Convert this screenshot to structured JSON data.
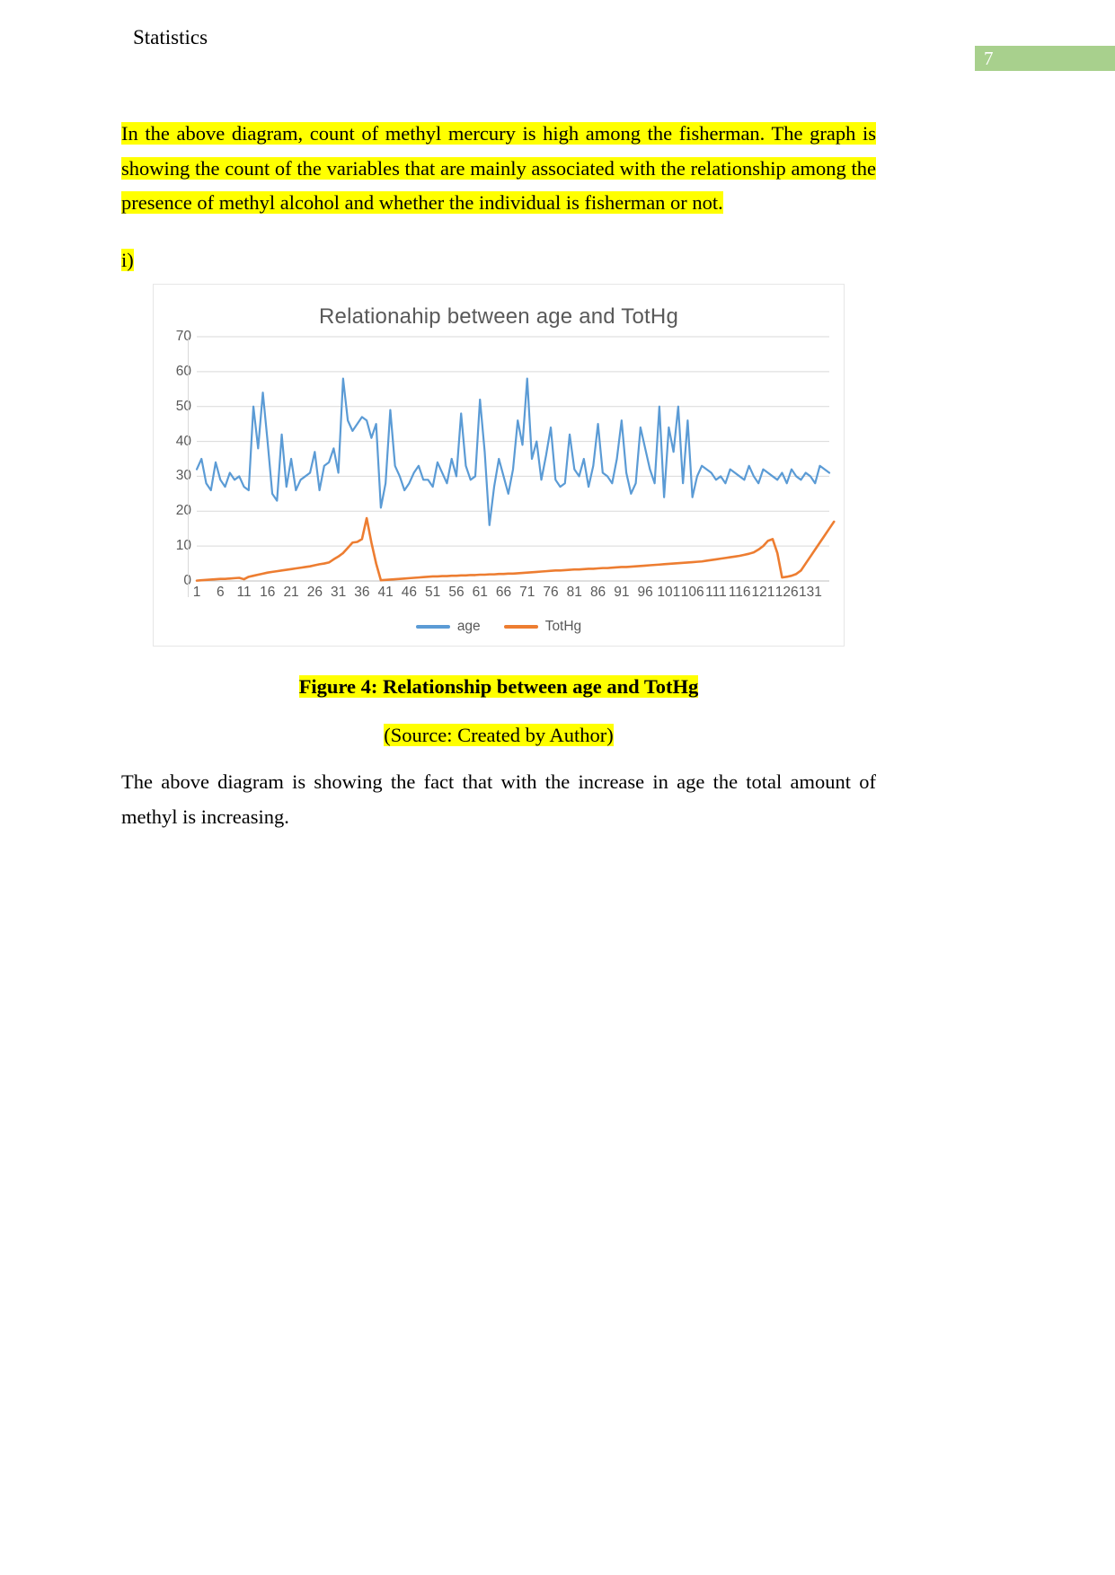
{
  "header": {
    "title": "Statistics",
    "page_number": "7",
    "page_number_bar_color": "#a8d08d"
  },
  "body": {
    "paragraph_1": "In the above diagram, count of methyl mercury is high among the fisherman. The graph is showing the count of the variables that are mainly associated with the relationship among the presence of methyl alcohol and whether the individual is fisherman or not.",
    "list_marker": "i)",
    "closing_paragraph": "The above diagram is showing the fact that with the increase in age the total amount of methyl is increasing.",
    "highlight_color": "#ffff00"
  },
  "figure": {
    "caption": "Figure 4: Relationship between age and TotHg",
    "source": "(Source: Created by Author)"
  },
  "chart_data": {
    "type": "line",
    "title": "Relationahip  between age and  TotHg",
    "xlabel": "",
    "ylabel": "",
    "ylim": [
      0,
      70
    ],
    "yticks": [
      0,
      10,
      20,
      30,
      40,
      50,
      60,
      70
    ],
    "xticks": [
      1,
      6,
      11,
      16,
      21,
      26,
      31,
      36,
      41,
      46,
      51,
      56,
      61,
      66,
      71,
      76,
      81,
      86,
      91,
      96,
      101,
      106,
      111,
      116,
      121,
      126,
      131
    ],
    "xlim": [
      1,
      135
    ],
    "grid": true,
    "legend_position": "bottom",
    "colors": {
      "age": "#5b9bd5",
      "TotHg": "#ed7d31"
    },
    "series": [
      {
        "name": "age",
        "color": "#5b9bd5",
        "values": [
          32,
          35,
          28,
          26,
          34,
          29,
          27,
          31,
          29,
          30,
          27,
          26,
          50,
          38,
          54,
          40,
          25,
          23,
          42,
          27,
          35,
          26,
          29,
          30,
          31,
          37,
          26,
          33,
          34,
          38,
          31,
          58,
          46,
          43,
          45,
          47,
          46,
          41,
          45,
          21,
          28,
          49,
          33,
          30,
          26,
          28,
          31,
          33,
          29,
          29,
          27,
          34,
          31,
          28,
          35,
          30,
          48,
          33,
          29,
          30,
          52,
          37,
          16,
          27,
          35,
          30,
          25,
          32,
          46,
          39,
          58,
          35,
          40,
          29,
          36,
          44,
          29,
          27,
          28,
          42,
          32,
          30,
          35,
          27,
          33,
          45,
          31,
          30,
          28,
          35,
          46,
          31,
          25,
          28,
          44,
          38,
          32,
          28,
          50,
          24,
          44,
          37,
          50,
          28,
          46,
          24,
          30,
          33,
          32,
          31,
          29,
          30,
          28,
          32,
          31,
          30,
          29,
          33,
          30,
          28,
          32,
          31,
          30,
          29,
          31,
          28,
          32,
          30,
          29,
          31,
          30,
          28,
          33,
          32,
          31
        ]
      },
      {
        "name": "TotHg",
        "color": "#ed7d31",
        "values": [
          0.1,
          0.2,
          0.3,
          0.4,
          0.5,
          0.6,
          0.6,
          0.7,
          0.8,
          0.9,
          0.5,
          1.2,
          1.5,
          1.8,
          2.1,
          2.4,
          2.6,
          2.8,
          3.0,
          3.2,
          3.4,
          3.6,
          3.8,
          4.0,
          4.2,
          4.5,
          4.8,
          5.0,
          5.3,
          6.2,
          7.0,
          8.0,
          9.5,
          11.0,
          11.2,
          12.0,
          18.0,
          11.0,
          5.0,
          0.2,
          0.3,
          0.4,
          0.5,
          0.6,
          0.7,
          0.8,
          0.9,
          1.0,
          1.1,
          1.2,
          1.3,
          1.3,
          1.4,
          1.4,
          1.5,
          1.5,
          1.6,
          1.6,
          1.7,
          1.7,
          1.8,
          1.8,
          1.9,
          1.9,
          2.0,
          2.0,
          2.1,
          2.1,
          2.2,
          2.3,
          2.4,
          2.5,
          2.6,
          2.7,
          2.8,
          2.9,
          3.0,
          3.0,
          3.1,
          3.2,
          3.3,
          3.3,
          3.4,
          3.5,
          3.5,
          3.6,
          3.7,
          3.7,
          3.8,
          3.9,
          4.0,
          4.0,
          4.1,
          4.2,
          4.3,
          4.4,
          4.5,
          4.6,
          4.7,
          4.8,
          4.9,
          5.0,
          5.1,
          5.2,
          5.3,
          5.4,
          5.5,
          5.6,
          5.8,
          6.0,
          6.2,
          6.4,
          6.6,
          6.8,
          7.0,
          7.2,
          7.5,
          7.8,
          8.2,
          9.0,
          10.0,
          11.5,
          12.0,
          8.0,
          1.0,
          1.2,
          1.5,
          2.0,
          3.0,
          5.0,
          7.0,
          9.0,
          11.0,
          13.0,
          15.0,
          17.0
        ]
      }
    ],
    "legend": [
      "age",
      "TotHg"
    ]
  }
}
